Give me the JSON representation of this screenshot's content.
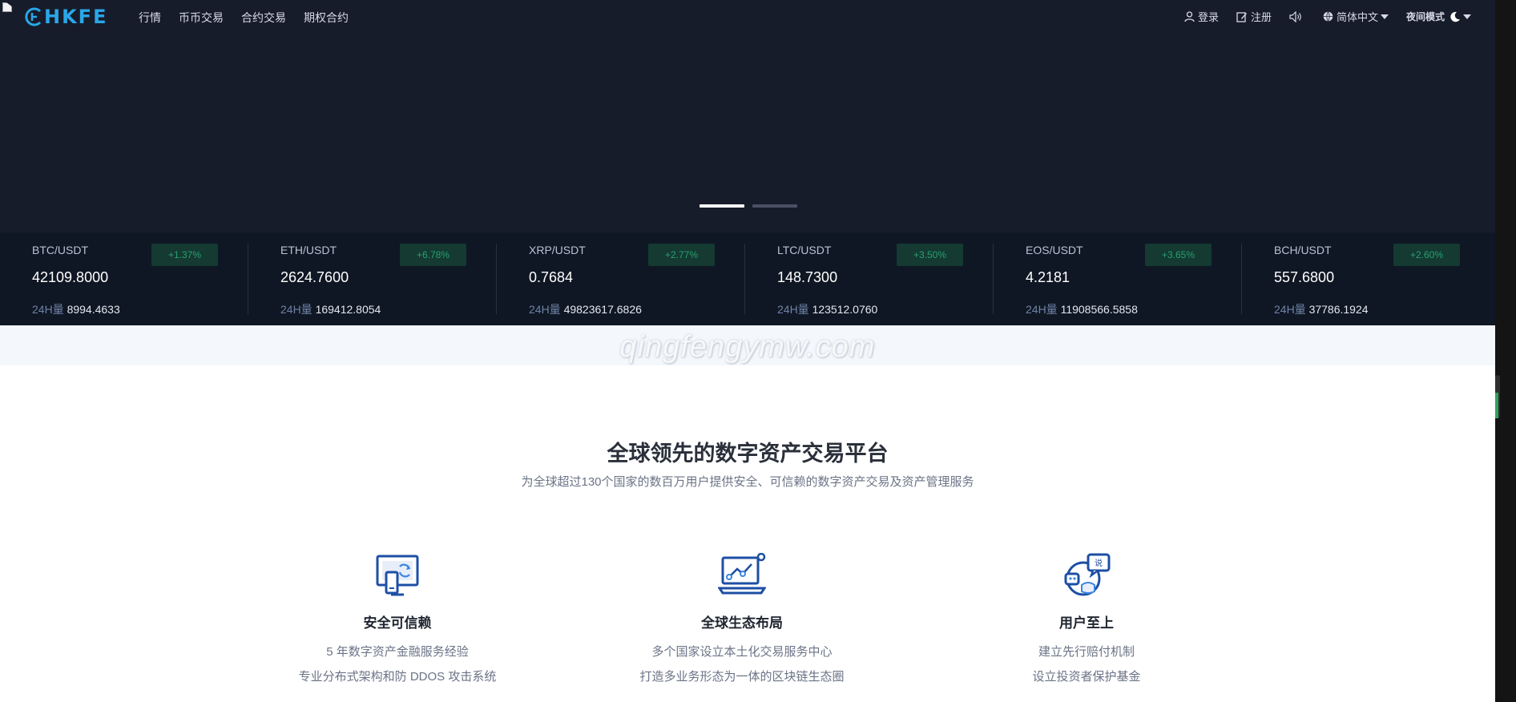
{
  "brand": {
    "logo_text": "HKFE",
    "accent": "#2aa7e8"
  },
  "nav": {
    "links": [
      "行情",
      "币币交易",
      "合约交易",
      "期权合约"
    ],
    "login": "登录",
    "register": "注册",
    "language": "简体中文",
    "night_mode": "夜间模式"
  },
  "banner": {
    "slides": 2,
    "active_slide": 1
  },
  "ticker": {
    "volume_label": "24H量",
    "items": [
      {
        "pair": "BTC/USDT",
        "change": "+1.37%",
        "price": "42109.8000",
        "volume": "8994.4633"
      },
      {
        "pair": "ETH/USDT",
        "change": "+6.78%",
        "price": "2624.7600",
        "volume": "169412.8054"
      },
      {
        "pair": "XRP/USDT",
        "change": "+2.77%",
        "price": "0.7684",
        "volume": "49823617.6826"
      },
      {
        "pair": "LTC/USDT",
        "change": "+3.50%",
        "price": "148.7300",
        "volume": "123512.0760"
      },
      {
        "pair": "EOS/USDT",
        "change": "+3.65%",
        "price": "4.2181",
        "volume": "11908566.5858"
      },
      {
        "pair": "BCH/USDT",
        "change": "+2.60%",
        "price": "557.6800",
        "volume": "37786.1924"
      }
    ]
  },
  "watermark": "qingfengymw.com",
  "intro": {
    "title": "全球领先的数字资产交易平台",
    "subtitle": "为全球超过130个国家的数百万用户提供安全、可信赖的数字资产交易及资产管理服务"
  },
  "features": [
    {
      "icon": "secure-device-icon",
      "title": "安全可信赖",
      "lines": [
        "5 年数字资产金融服务经验",
        "专业分布式架构和防 DDOS 攻击系统"
      ]
    },
    {
      "icon": "global-chart-icon",
      "title": "全球生态布局",
      "lines": [
        "多个国家设立本土化交易服务中心",
        "打造多业务形态为一体的区块链生态圈"
      ]
    },
    {
      "icon": "user-support-icon",
      "title": "用户至上",
      "lines": [
        "建立先行赔付机制",
        "设立投资者保护基金"
      ]
    }
  ]
}
